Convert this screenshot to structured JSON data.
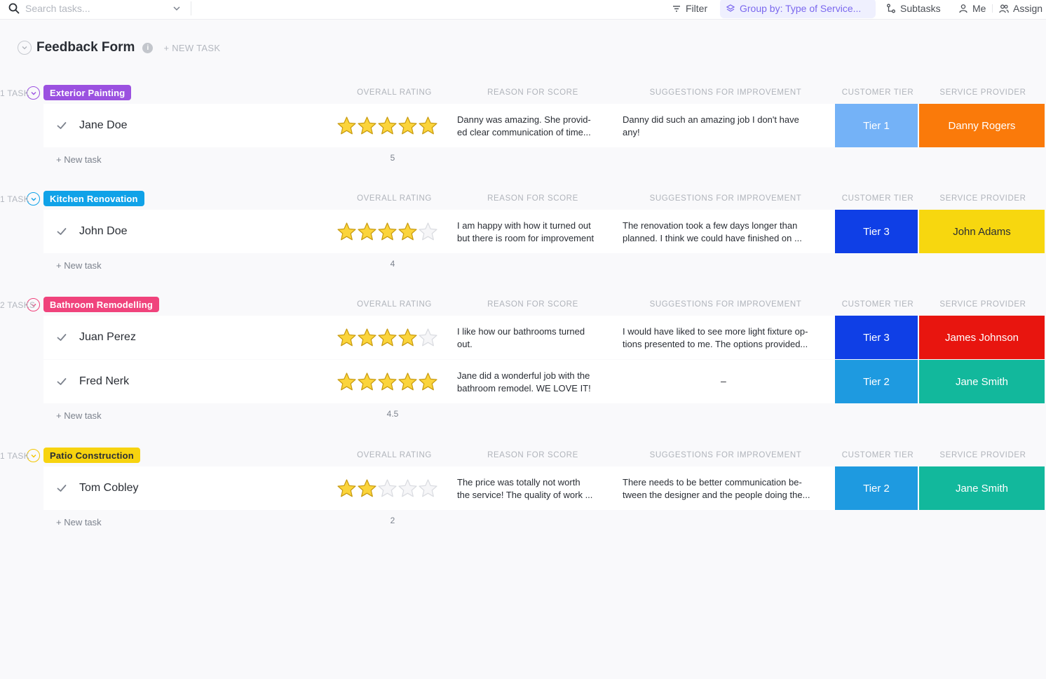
{
  "toolbar": {
    "search_placeholder": "Search tasks...",
    "filter_label": "Filter",
    "group_by_label": "Group by: Type of Service...",
    "subtasks_label": "Subtasks",
    "me_label": "Me",
    "assignees_label": "Assign"
  },
  "list": {
    "title": "Feedback Form",
    "new_task_label": "+ NEW TASK"
  },
  "columns": {
    "rating": "OVERALL RATING",
    "reason": "REASON FOR SCORE",
    "suggestions": "SUGGESTIONS FOR IMPROVEMENT",
    "tier": "CUSTOMER TIER",
    "provider": "SERVICE PROVIDER"
  },
  "groups": [
    {
      "name": "Exterior Painting",
      "count_label": "1 TASK",
      "color": "#9b51e0",
      "ring_color": "#9b51e0",
      "new_task": "+ New task",
      "avg_rating": "5",
      "tasks": [
        {
          "name": "Jane Doe",
          "rating": 5,
          "reason": "Danny was amazing. She provid-\ned clear communication of time...",
          "suggestion": "Danny did such an amazing job I don't have\nany!",
          "tier": "Tier 1",
          "tier_color": "#74b2f7",
          "provider": "Danny Rogers",
          "provider_color": "#fa7a0a"
        }
      ]
    },
    {
      "name": "Kitchen Renovation",
      "count_label": "1 TASK",
      "color": "#10a2e8",
      "ring_color": "#10a2e8",
      "new_task": "+ New task",
      "avg_rating": "4",
      "tasks": [
        {
          "name": "John Doe",
          "rating": 4,
          "reason": "I am happy with how it turned out\nbut there is room for improvement",
          "suggestion": "The renovation took a few days longer than\nplanned. I think we could have finished on ...",
          "tier": "Tier 3",
          "tier_color": "#0f3fe6",
          "provider": "John Adams",
          "provider_color": "#f7d70f"
        }
      ]
    },
    {
      "name": "Bathroom Remodelling",
      "count_label": "2 TASKS",
      "color": "#f0437c",
      "ring_color": "#f0437c",
      "new_task": "+ New task",
      "avg_rating": "4.5",
      "tasks": [
        {
          "name": "Juan Perez",
          "rating": 4,
          "reason": "I like how our bathrooms turned\nout.",
          "suggestion": "I would have liked to see more light fixture op-\ntions presented to me. The options provided...",
          "tier": "Tier 3",
          "tier_color": "#0f3fe6",
          "provider": "James Johnson",
          "provider_color": "#e8150f"
        },
        {
          "name": "Fred Nerk",
          "rating": 5,
          "reason": "Jane did a wonderful job with the\nbathroom remodel. WE LOVE IT!",
          "suggestion": "–",
          "tier": "Tier 2",
          "tier_color": "#1e9ae0",
          "provider": "Jane Smith",
          "provider_color": "#12b89c"
        }
      ]
    },
    {
      "name": "Patio Construction",
      "count_label": "1 TASK",
      "color": "#f7d30f",
      "ring_color": "#f2c500",
      "new_task": "+ New task",
      "avg_rating": "2",
      "tasks": [
        {
          "name": "Tom Cobley",
          "rating": 2,
          "reason": "The price was totally not worth\nthe service! The quality of work ...",
          "suggestion": "There needs to be better communication be-\ntween the designer and the people doing the...",
          "tier": "Tier 2",
          "tier_color": "#1e9ae0",
          "provider": "Jane Smith",
          "provider_color": "#12b89c"
        }
      ]
    }
  ]
}
